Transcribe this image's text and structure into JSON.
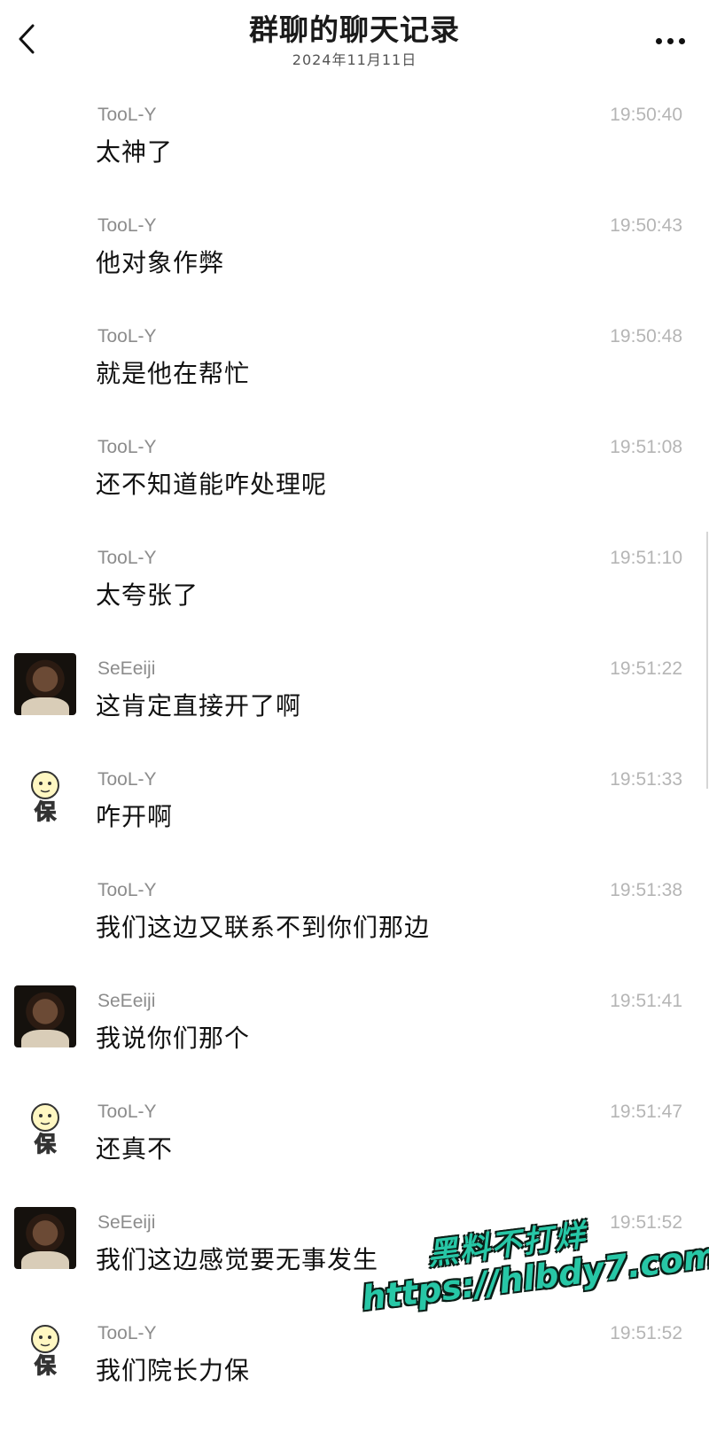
{
  "header": {
    "title": "群聊的聊天记录",
    "date": "2024年11月11日",
    "back_icon": "chevron-left-icon",
    "more_icon": "more-dots-icon"
  },
  "messages": [
    {
      "sender": "TooL-Y",
      "time": "19:50:40",
      "text": "太神了",
      "avatar": "none"
    },
    {
      "sender": "TooL-Y",
      "time": "19:50:43",
      "text": "他对象作弊",
      "avatar": "none"
    },
    {
      "sender": "TooL-Y",
      "time": "19:50:48",
      "text": "就是他在帮忙",
      "avatar": "none"
    },
    {
      "sender": "TooL-Y",
      "time": "19:51:08",
      "text": "还不知道能咋处理呢",
      "avatar": "none"
    },
    {
      "sender": "TooL-Y",
      "time": "19:51:10",
      "text": "太夸张了",
      "avatar": "none"
    },
    {
      "sender": "SeEeiji",
      "time": "19:51:22",
      "text": "这肯定直接开了啊",
      "avatar": "photo"
    },
    {
      "sender": "TooL-Y",
      "time": "19:51:33",
      "text": "咋开啊",
      "avatar": "sticker"
    },
    {
      "sender": "TooL-Y",
      "time": "19:51:38",
      "text": "我们这边又联系不到你们那边",
      "avatar": "none"
    },
    {
      "sender": "SeEeiji",
      "time": "19:51:41",
      "text": "我说你们那个",
      "avatar": "photo"
    },
    {
      "sender": "TooL-Y",
      "time": "19:51:47",
      "text": "还真不",
      "avatar": "sticker"
    },
    {
      "sender": "SeEeiji",
      "time": "19:51:52",
      "text": "我们这边感觉要无事发生",
      "avatar": "photo"
    },
    {
      "sender": "TooL-Y",
      "time": "19:51:52",
      "text": "我们院长力保",
      "avatar": "sticker"
    }
  ],
  "watermark": {
    "line1": "黑料不打烊",
    "line2": "https://hlbdy7.com"
  },
  "colors": {
    "sender": "#8c8c8c",
    "time": "#b5b5b5",
    "watermark": "#27c7a6"
  }
}
